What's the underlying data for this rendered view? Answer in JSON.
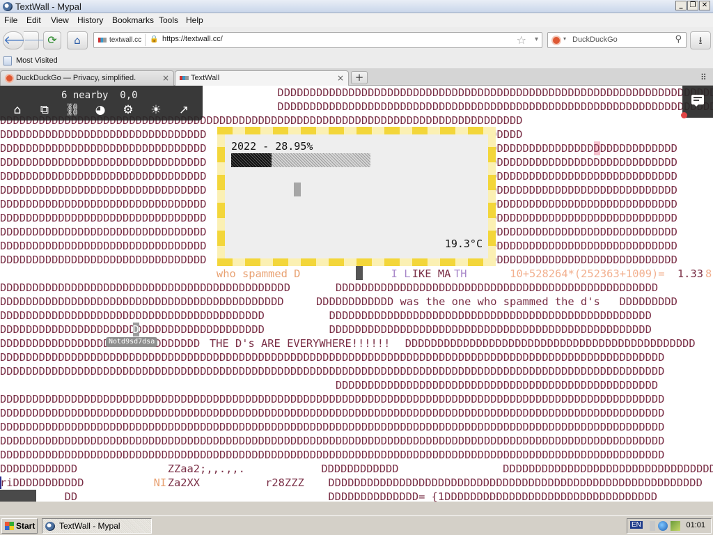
{
  "window": {
    "title": "TextWall - Mypal",
    "min": "_",
    "max": "❐",
    "close": "✕"
  },
  "menu": [
    "File",
    "Edit",
    "View",
    "History",
    "Bookmarks",
    "Tools",
    "Help"
  ],
  "nav": {
    "back": "🡐",
    "forward": "🡒",
    "reload": "⟳",
    "home": "⌂",
    "site_label": "textwall.cc",
    "lock": "🔒",
    "url": "https://textwall.cc/",
    "star": "☆",
    "dropdown": "▾",
    "search_placeholder": "DuckDuckGo",
    "search_dropdown": "▾",
    "search_icon": "⚲",
    "download": "⭳"
  },
  "bookmarks": {
    "most_visited": "Most Visited"
  },
  "tabs": [
    {
      "label": "DuckDuckGo — Privacy, simplified.",
      "close": "×"
    },
    {
      "label": "TextWall",
      "close": "×"
    }
  ],
  "newtab": "+",
  "tablist": "⠿",
  "textwall": {
    "toolbar_status": "6 nearby  0,0",
    "toolbar_icons": {
      "home": "⌂",
      "copy": "⧉",
      "link": "⛓",
      "palette": "◕",
      "settings": "⚙",
      "brightness": "☀",
      "expand": "↗"
    },
    "widget": {
      "title": "2022 - 28.95%",
      "progress": 0.2895,
      "temperature": "19.3°C"
    },
    "name_tag": "Notd9sd7dsa",
    "lines": [
      {
        "text": "                                           DDDDDDDDDDDDDDDDDDDDDDDDDDDDDDDDDDDDDDDDDDDDDDDDDDDDDDDDDDDDDDDDDDDDDDDDDDDDDDDDDDDDDDDD"
      },
      {
        "text": "                                           DDDDDDDDDDDDDDDDDDDDDDDDDDDDDDDDDDDDDDDDDDDDDDDDDDDDDDDDDDDDDDDDDDDDDDDDDD"
      },
      {
        "text": "DDDDDDDDDDDDDDDDDDDDDDDDDDDDDDDDDDDDDDDDDDDDDDDDDDDDDDDDDDDDDDDDDDDDDDDDDDDDDDDDD"
      },
      {
        "text": "DDDDDDDDDDDDDDDDDDDDDDDDDDDDDDDD                                        DDDDDDDDD"
      },
      {
        "text": "DDDDDDDDDDDDDDDDDDDDDDDDDDDDDDDD                                        DDDDDDDDDDDDDDDDDDDDDDDDDDDDDDDDD"
      },
      {
        "text": "DDDDDDDDDDDDDDDDDDDDDDDDDDDDDDDD                                        DDDDDDDDDDDDDDDDDDDDDDDDDDDDDDDDD"
      },
      {
        "text": "DDDDDDDDDDDDDDDDDDDDDDDDDDDDDDDD                                        DDDDDDDDDDDDDDDDDDDDDDDDDDDDDDDDD"
      },
      {
        "text": "DDDDDDDDDDDDDDDDDDDDDDDDDDDDDDDD                                        DDDDDDDDDDDDDDDDDDDDDDDDDDDDDDDDD"
      },
      {
        "text": "DDDDDDDDDDDDDDDDDDDDDDDDDDDDDDDD                                        DDDDDDDDDDDDDDDDDDDDDDDDDDDDDDDDD"
      },
      {
        "text": "DDDDDDDDDDDDDDDDDDDDDDDDDDDDDDDD                                        DDDDDDDDDDDDDDDDDDDDDDDDDDDDDDDDD"
      },
      {
        "text": "DDDDDDDDDDDDDDDDDDDDDDDDDDDDDDDD                                        DDDDDDDDDDDDDDDDDDDDDDDDDDDDDDDDD"
      },
      {
        "text": "DDDDDDDDDDDDDDDDDDDDDDDDDDDDDDDD                                        DDDDDDDDDDDDDDDDDDDDDDDDDDDDDDDDD"
      },
      {
        "text": "DDDDDDDDDDDDDDDDDDDDDDDDDDDDDDDD                                        DDDDDDDDDDDDDDDDDDDDDDDDDDDDDDDDD"
      },
      {
        "text": ""
      },
      {
        "text": "DDDDDDDDDDDDDDDDDDDDDDDDDDDDDDDDDDDDDDDDDDDDD       DDDDDDDDDDDDDDDDDDDDDDDDDDDDDDDDDDDDDDDDDDDDDDDDDD"
      },
      {
        "text": "DDDDDDDDDDDDDDDDDDDDDDDDDDDDDDDDDDDDDDDDDDDD     DDDDDDDDDDDD was the one who spammed the d's   DDDDDDDDD"
      },
      {
        "text": "DDDDDDDDDDDDDDDDDDDDDDDDDDDDDDDDDDDDDDDDD          DDDDDDDDDDDDDDDDDDDDDDDDDDDDDDDDDDDDDDDDDDDDDDDDDD"
      },
      {
        "text": "DDDDDDDDDDDDDDDDDDDDDDDDDDDDDDDDDDDDDDDDD          DDDDDDDDDDDDDDDDDDDDDDDDDDDDDDDDDDDDDDDDDDDDDDDDDD"
      },
      {
        "text": ""
      },
      {
        "text": "DDDDDDDDDDDDDDDDDDDDDDDDDDDDDDDDDDDDDDDDDDDDDDDDDDDDDDDDDDDDDDDDDDDDDDDDDDDDDDDDDDDDDDDDDDDDDDDDDDDDDDD"
      },
      {
        "text": "DDDDDDDDDDDDDDDDDDDDDDDDDDDDDDDDDDDDDDDDDDDDDDDDDDDDDDDDDDDDDDDDDDDDDDDDDDDDDDDDDDDDDDDDDDDDDDDDDDDDDDD"
      },
      {
        "text": "                                                    DDDDDDDDDDDDDDDDDDDDDDDDDDDDDDDDDDDDDDDDDDDDDDDDDD"
      },
      {
        "text": "DDDDDDDDDDDDDDDDDDDDDDDDDDDDDDDDDDDDDDDDDDDDDDDDDDDDDDDDDDDDDDDDDDDDDDDDDDDDDDDDDDDDDDDDDDDDDDDDDDDDDDD"
      },
      {
        "text": "DDDDDDDDDDDDDDDDDDDDDDDDDDDDDDDDDDDDDDDDDDDDDDDDDDDDDDDDDDDDDDDDDDDDDDDDDDDDDDDDDDDDDDDDDDDDDDDDDDDDDDD"
      },
      {
        "text": "DDDDDDDDDDDDDDDDDDDDDDDDDDDDDDDDDDDDDDDDDDDDDDDDDDDDDDDDDDDDDDDDDDDDDDDDDDDDDDDDDDDDDDDDDDDDDDDDDDDDDDD"
      },
      {
        "text": "DDDDDDDDDDDDDDDDDDDDDDDDDDDDDDDDDDDDDDDDDDDDDDDDDDDDDDDDDDDDDDDDDDDDDDDDDDDDDDDDDDDDDDDDDDDDDDDDDDDDDDD"
      },
      {
        "text": "DDDDDDDDDDDDDDDDDDDDDDDDDDDDDDDDDDDDDDDDDDDDDDDDDDDDDDDDDDDDDDDDDDDDDDDDDDDDDDDDDDDDDDDDDDDDDDDDDDDDDDD"
      },
      {
        "text": "DDDDDDDDDDDD"
      },
      {
        "text": "riDDDDDDDDDDD"
      },
      {
        "text": "          DD"
      }
    ],
    "segments": {
      "who_spammed": "who spammed D",
      "i_like": "I L",
      "ike_ma": "IKE MA",
      "th": "TH",
      "math_expr": "10+528264*(252363+1009)=",
      "math_result": "1.33",
      "math_tail": "8",
      "everywhere_pre": "DDDDDDDDDDDDDDDDDDDDDDDDDDDDDDD",
      "everywhere": "THE D's ARE EVERYWHERE!!!!!!",
      "everywhere_post": "DDDDDDDDDDDDDDDDDDDDDDDDDDDDDDDDDDDDDDDDDDDDD",
      "zzaa": "ZZaa2;,,.,,.",
      "ni": "NI",
      "za2xx": "Za2XX",
      "r28zzz": "r28ZZZ",
      "dd_row27b": "DDDDDDDDDDDD",
      "dd_row27c": "DDDDDDDDDDDDDDDDDDDDDDDDDDDDDDDDDDDDDDDDDDDDDDDDDDD",
      "dd_row28": "DDDDDDDDDDDDDDDDDDDDDDDDDDDDDDDDDDDDDDDDDDDDDDDDDDDDDDDDDD",
      "dd_row29": "DDDDDDDDDDDDDD= {1DDDDDDDDDDDDDDDDDDDDDDDDDDDDDDDDD"
    }
  },
  "taskbar": {
    "start": "Start",
    "task": "TextWall - Mypal",
    "lang": "EN",
    "clock": "01:01"
  }
}
